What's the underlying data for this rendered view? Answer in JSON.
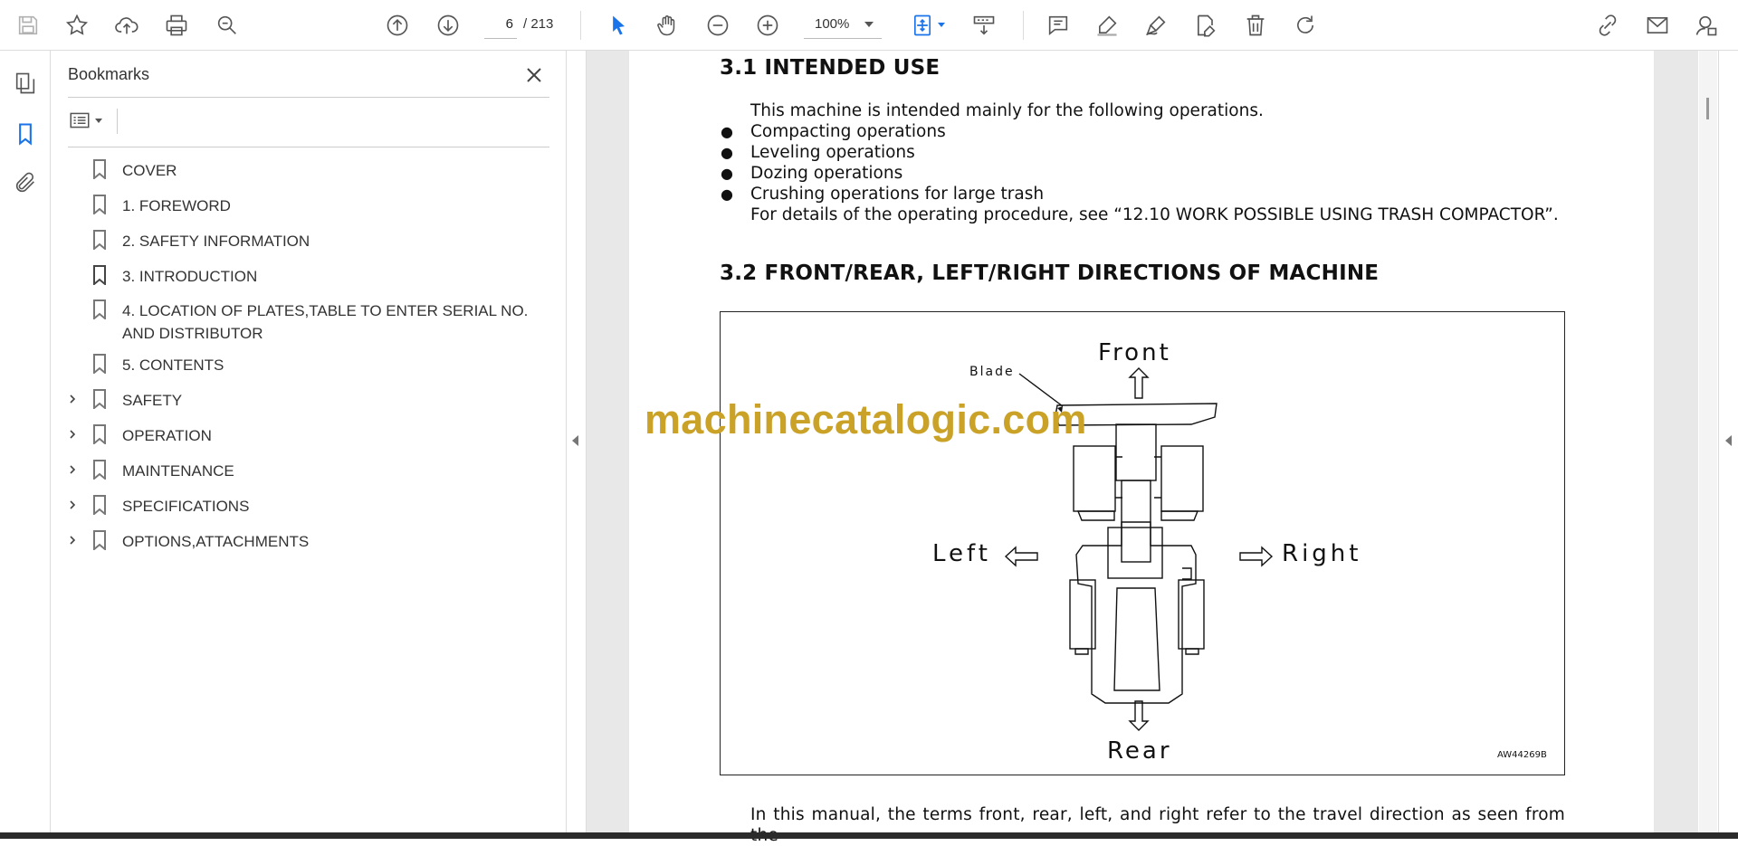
{
  "toolbar": {
    "current_page": "6",
    "page_total": "/  213",
    "zoom": "100%"
  },
  "panel": {
    "title": "Bookmarks",
    "bookmarks": [
      {
        "label": "COVER",
        "expandable": false
      },
      {
        "label": "1. FOREWORD",
        "expandable": false
      },
      {
        "label": "2. SAFETY INFORMATION",
        "expandable": false
      },
      {
        "label": "3. INTRODUCTION",
        "expandable": false,
        "selected": true
      },
      {
        "label": "4. LOCATION OF PLATES,TABLE TO ENTER SERIAL NO. AND DISTRIBUTOR",
        "expandable": false
      },
      {
        "label": "5. CONTENTS",
        "expandable": false
      },
      {
        "label": "SAFETY",
        "expandable": true
      },
      {
        "label": "OPERATION",
        "expandable": true
      },
      {
        "label": "MAINTENANCE",
        "expandable": true
      },
      {
        "label": "SPECIFICATIONS",
        "expandable": true
      },
      {
        "label": "OPTIONS,ATTACHMENTS",
        "expandable": true
      }
    ]
  },
  "document": {
    "section1_heading": "3.1  INTENDED USE",
    "section1_intro": "This machine is intended mainly for the following operations.",
    "section1_bullets": [
      "Compacting operations",
      "Leveling operations",
      "Dozing operations",
      "Crushing operations for large trash"
    ],
    "section1_details": "For details of the operating procedure, see “12.10 WORK POSSIBLE USING TRASH COMPACTOR”.",
    "section2_heading": "3.2  FRONT/REAR, LEFT/RIGHT DIRECTIONS OF MACHINE",
    "figure": {
      "front": "Front",
      "rear": "Rear",
      "left": "Left",
      "right": "Right",
      "blade": "Blade",
      "code": "AW44269B"
    },
    "bottom_text": "In this manual, the terms front, rear, left, and right refer to the travel direction as seen from the",
    "watermark": "machinecatalogic.com"
  },
  "colors": {
    "accent": "#1a73e8",
    "watermark": "#c9a227",
    "viewer_bg": "#e8e8e8"
  }
}
